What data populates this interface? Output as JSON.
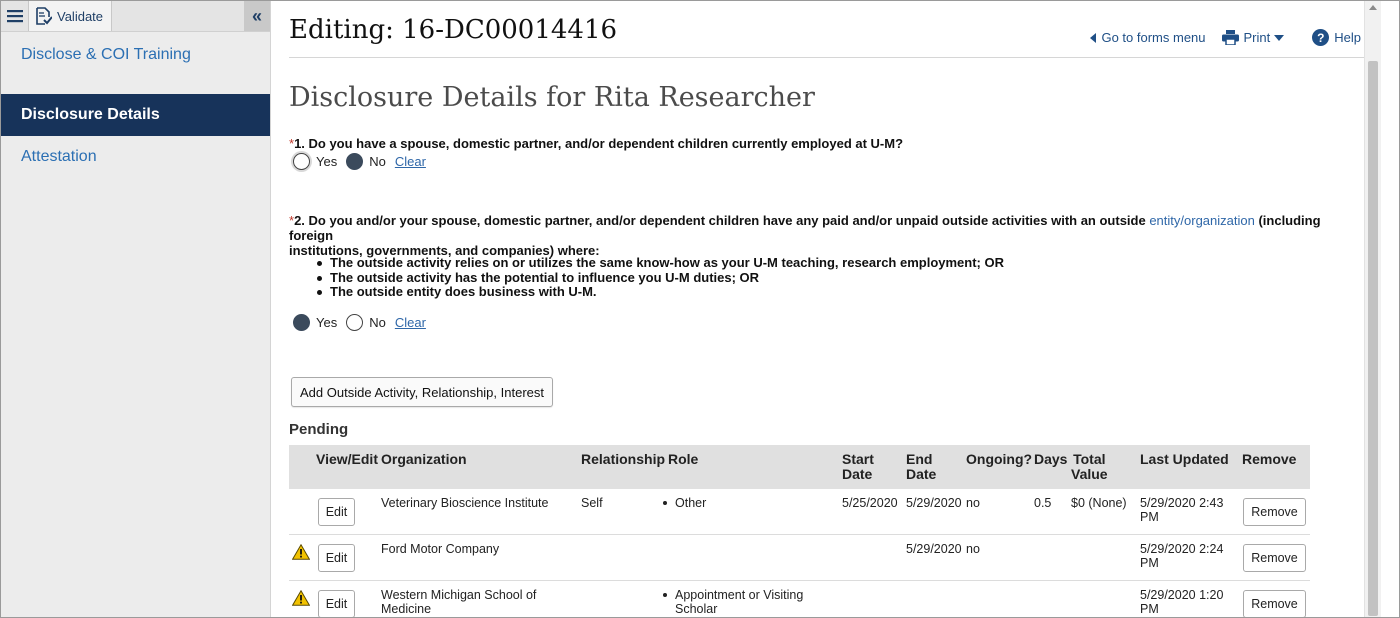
{
  "sidebar": {
    "validate_label": "Validate",
    "items": [
      {
        "label": "Disclose & COI Training",
        "active": false
      },
      {
        "label": "Disclosure Details",
        "active": true
      },
      {
        "label": "Attestation",
        "active": false
      }
    ]
  },
  "header": {
    "title": "Editing: 16-DC00014416",
    "links": {
      "forms_menu": "Go to forms menu",
      "print": "Print",
      "help": "Help"
    }
  },
  "section_title": "Disclosure Details for Rita Researcher",
  "questions": {
    "q1": {
      "required_mark": "*",
      "text": "1. Do you have a spouse, domestic partner, and/or dependent children currently employed at U-M?",
      "yes": "Yes",
      "no": "No",
      "clear": "Clear",
      "selected": "No"
    },
    "q2": {
      "required_mark": "*",
      "text_pre": "2. Do you and/or your spouse, domestic partner, and/or dependent children have any paid and/or unpaid outside activities with an outside ",
      "entity_link": "entity/organization",
      "text_post_line1": " (including foreign",
      "text_line2": "institutions, governments, and companies) where:",
      "bullets": [
        "The outside activity relies on or utilizes the same know-how as your U-M teaching, research employment; OR",
        "The outside activity has the potential to influence you U-M duties; OR",
        "The outside entity does business with U-M."
      ],
      "yes": "Yes",
      "no": "No",
      "clear": "Clear",
      "selected": "Yes"
    }
  },
  "add_button": "Add Outside Activity, Relationship, Interest",
  "pending": {
    "title": "Pending",
    "columns": {
      "view_edit": "View/Edit",
      "organization": "Organization",
      "relationship": "Relationship",
      "role": "Role",
      "start_date_1": "Start",
      "start_date_2": "Date",
      "end_date_1": "End",
      "end_date_2": "Date",
      "ongoing": "Ongoing?",
      "days": "Days",
      "total_value_1": "Total",
      "total_value_2": "Value",
      "last_updated": "Last Updated",
      "remove": "Remove"
    },
    "edit_label": "Edit",
    "remove_label": "Remove",
    "rows": [
      {
        "warning": false,
        "organization_1": "Veterinary Bioscience Institute",
        "organization_2": "",
        "relationship": "Self",
        "role_1": "Other",
        "role_2": "",
        "start_date": "5/25/2020",
        "end_date": "5/29/2020",
        "ongoing": "no",
        "days": "0.5",
        "total_value": "$0 (None)",
        "last_updated_1": "5/29/2020 2:43",
        "last_updated_2": "PM"
      },
      {
        "warning": true,
        "organization_1": "Ford Motor Company",
        "organization_2": "",
        "relationship": "",
        "role_1": "",
        "role_2": "",
        "start_date": "",
        "end_date": "5/29/2020",
        "ongoing": "no",
        "days": "",
        "total_value": "",
        "last_updated_1": "5/29/2020 2:24",
        "last_updated_2": "PM"
      },
      {
        "warning": true,
        "organization_1": "Western Michigan School of",
        "organization_2": "Medicine",
        "relationship": "",
        "role_1": "Appointment or Visiting",
        "role_2": "Scholar",
        "start_date": "",
        "end_date": "",
        "ongoing": "",
        "days": "",
        "total_value": "",
        "last_updated_1": "5/29/2020 1:20",
        "last_updated_2": "PM"
      }
    ]
  }
}
